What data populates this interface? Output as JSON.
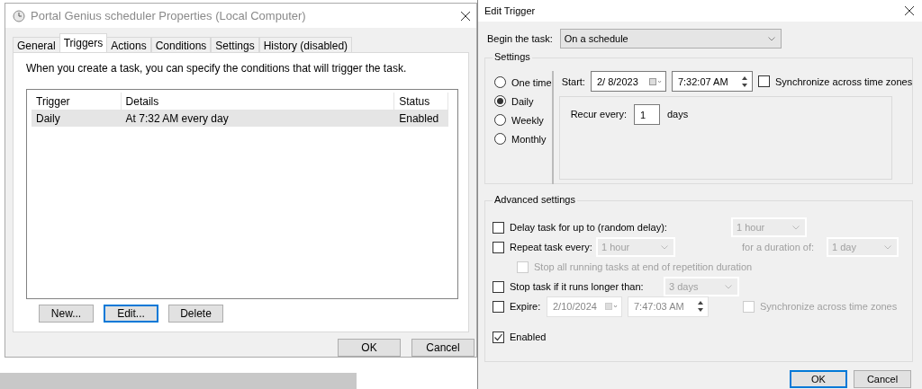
{
  "properties_dialog": {
    "title": "Portal Genius scheduler Properties (Local Computer)",
    "tabs": [
      {
        "label": "General",
        "selected": false
      },
      {
        "label": "Triggers",
        "selected": true
      },
      {
        "label": "Actions",
        "selected": false
      },
      {
        "label": "Conditions",
        "selected": false
      },
      {
        "label": "Settings",
        "selected": false
      },
      {
        "label": "History (disabled)",
        "selected": false
      }
    ],
    "description": "When you create a task, you can specify the conditions that will trigger the task.",
    "table": {
      "columns": [
        "Trigger",
        "Details",
        "Status"
      ],
      "rows": [
        {
          "cells": [
            "Daily",
            "At 7:32 AM every day",
            "Enabled"
          ],
          "selected": true
        }
      ]
    },
    "buttons": [
      {
        "label": "New...",
        "focused": false
      },
      {
        "label": "Edit...",
        "focused": true
      },
      {
        "label": "Delete",
        "focused": false
      }
    ],
    "footer_buttons": [
      {
        "label": "OK",
        "focused": false
      },
      {
        "label": "Cancel",
        "focused": false
      }
    ]
  },
  "edit_trigger": {
    "title": "Edit Trigger",
    "begin_label": "Begin the task:",
    "begin_value": "On a schedule",
    "settings_title": "Settings",
    "schedules": [
      {
        "label": "One time",
        "selected": false
      },
      {
        "label": "Daily",
        "selected": true
      },
      {
        "label": "Weekly",
        "selected": false
      },
      {
        "label": "Monthly",
        "selected": false
      }
    ],
    "start_label": "Start:",
    "start_date": "2/ 8/2023",
    "start_time": "7:32:07 AM",
    "sync": {
      "label": "Synchronize across time zones",
      "checked": false,
      "disabled": false
    },
    "recur_label": "Recur every:",
    "recur_value": "1",
    "recur_unit": "days",
    "advanced_title": "Advanced settings",
    "delay": {
      "label": "Delay task for up to (random delay):",
      "checked": false,
      "value": "1 hour",
      "value_disabled": true
    },
    "repeat": {
      "label": "Repeat task every:",
      "checked": false,
      "value": "1 hour",
      "value_disabled": true,
      "duration_label": "for a duration of:",
      "duration_value": "1 day"
    },
    "stop_all": {
      "label": "Stop all running tasks at end of repetition duration",
      "checked": false,
      "disabled": true
    },
    "stop_task": {
      "label": "Stop task if it runs longer than:",
      "checked": false,
      "value": "3 days",
      "value_disabled": true
    },
    "expire": {
      "label": "Expire:",
      "checked": false,
      "date": "2/10/2024",
      "time": "7:47:03 AM",
      "fields_disabled": true
    },
    "expire_sync": {
      "label": "Synchronize across time zones",
      "checked": false,
      "disabled": true
    },
    "enabled": {
      "label": "Enabled",
      "checked": true,
      "disabled": false
    },
    "buttons": [
      {
        "label": "OK",
        "focused": true
      },
      {
        "label": "Cancel",
        "focused": false
      }
    ]
  }
}
